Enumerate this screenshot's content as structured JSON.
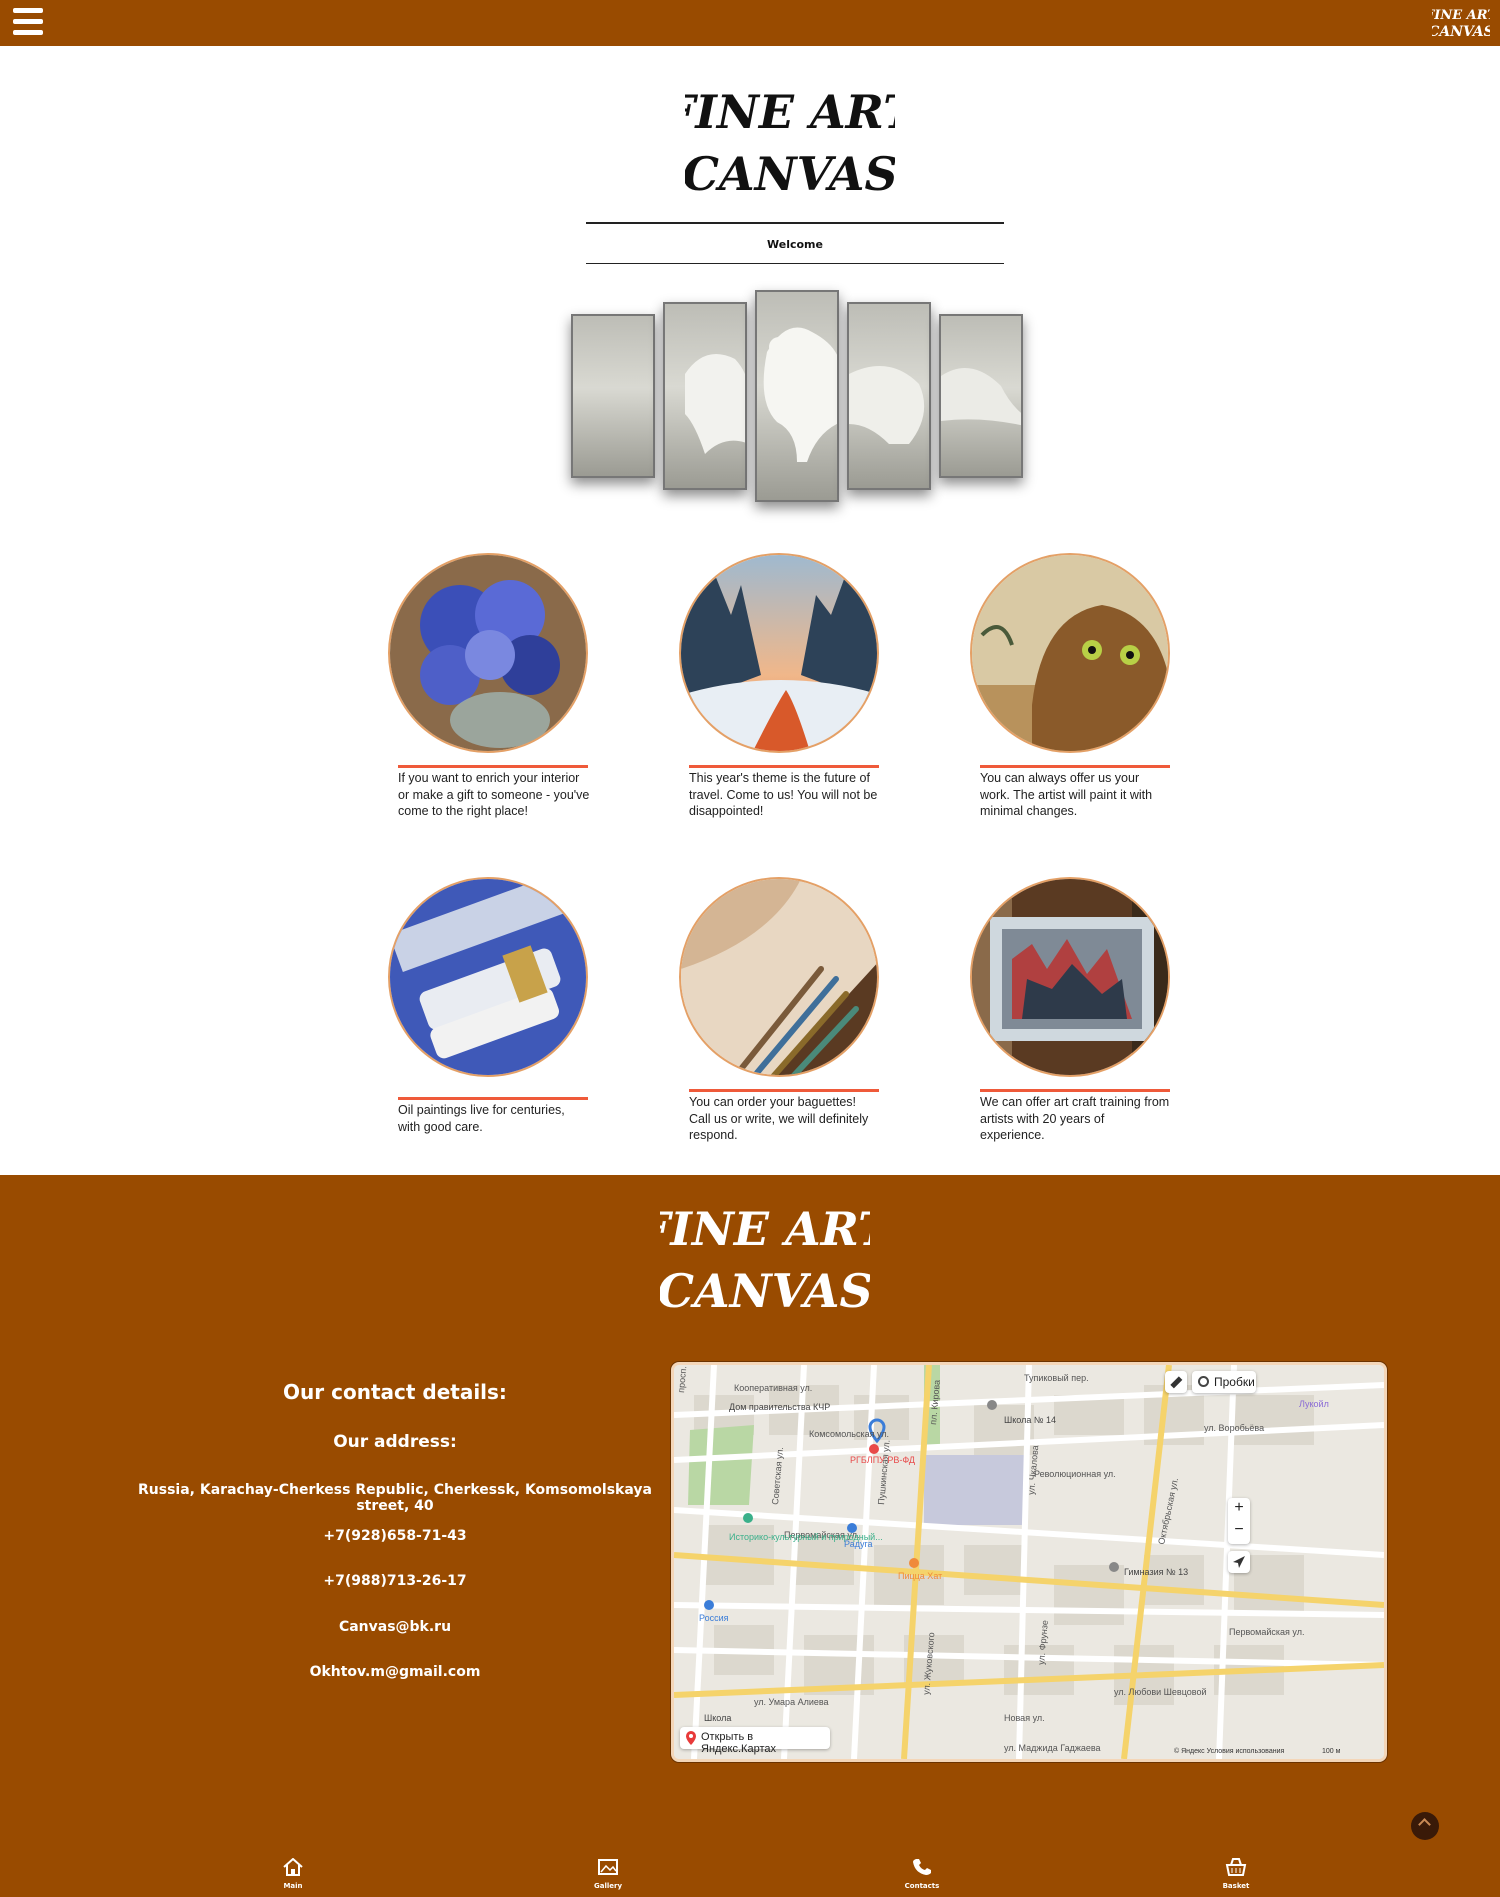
{
  "header": {
    "menu_icon": "hamburger-icon",
    "logo_lines": [
      "FINE ART",
      "CANVAS"
    ]
  },
  "hero": {
    "logo_lines": [
      "FINE ART",
      "CANVAS"
    ],
    "welcome": "Welcome"
  },
  "cards": [
    {
      "image": "blue-flowers-painting",
      "text": "If you want to enrich your interior or make a gift to someone - you've come to the right place!"
    },
    {
      "image": "winter-sunset-painting",
      "text": "This year's theme is the future of travel. Come to us! You will not be disappointed!"
    },
    {
      "image": "cat-painting",
      "text": "You can always offer us your work. The artist will paint it with minimal changes."
    },
    {
      "image": "oil-paint-tubes",
      "text": "Oil paintings live for centuries, with good care."
    },
    {
      "image": "brushes-on-canvas",
      "text": "You can order your baguettes! Call us or write, we will definitely respond."
    },
    {
      "image": "framed-painting",
      "text": "We can offer art craft training from artists with 20 years of experience."
    }
  ],
  "footer": {
    "logo_lines": [
      "FINE ART",
      "CANVAS"
    ],
    "contact_title": "Our contact details:",
    "address_title": "Our address:",
    "address": "Russia, Karachay-Cherkess Republic, Cherkessk, Komsomolskaya street, 40",
    "phone1": "+7(928)658-71-43",
    "phone2": "+7(988)713-26-17",
    "email1": "Canvas@bk.ru",
    "email2": "Okhtov.m@gmail.com"
  },
  "map": {
    "traffic_label": "Пробки",
    "open_label": "Открыть в Яндекс.Картах",
    "copyright": "© Яндекс  Условия использования",
    "scale": "100 м",
    "streets": [
      "Кооперативная ул.",
      "Комсомольская ул.",
      "Первомайская ул.",
      "ул. Умара Алиева",
      "Октябрьская ул.",
      "Революционная ул.",
      "ул. Воробьёва",
      "Тупиковый пер.",
      "просп. Ленина",
      "пл. Кирова",
      "Пушкинская ул.",
      "Советская ул.",
      "ул. Чкалова",
      "ул. Фрунзе",
      "ул. Жуковского",
      "Новая ул.",
      "ул. Любови Шевцовой",
      "Первомайская ул.",
      "ул. Маджида Гаджаева"
    ],
    "places": [
      "Дом правительства КЧР",
      "РГБЛПУ РВ-ФД",
      "Школа № 14",
      "Лукойл",
      "Историко-культурный и природный...",
      "Радуга",
      "Пицца Хат",
      "Гимназия № 13",
      "Россия",
      "Школа"
    ]
  },
  "bottom_nav": [
    {
      "icon": "home-icon",
      "label": "Main"
    },
    {
      "icon": "gallery-icon",
      "label": "Gallery"
    },
    {
      "icon": "phone-icon",
      "label": "Contacts"
    },
    {
      "icon": "basket-icon",
      "label": "Basket"
    }
  ],
  "colors": {
    "brand": "#994b00",
    "accent_line": "#ef5a3a",
    "circle_border": "#e4a066"
  }
}
